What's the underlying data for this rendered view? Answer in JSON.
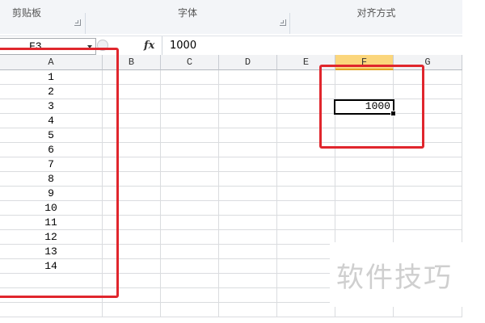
{
  "ribbon": {
    "groups": [
      {
        "caption": "剪贴板"
      },
      {
        "caption": "字体"
      },
      {
        "caption": "对齐方式"
      }
    ]
  },
  "formula_bar": {
    "name_box": "F3",
    "fx_label": "fx",
    "formula": "1000"
  },
  "grid": {
    "columns": [
      "A",
      "B",
      "C",
      "D",
      "E",
      "F",
      "G"
    ],
    "active_column": "F",
    "column_a_values": [
      "1",
      "2",
      "3",
      "4",
      "5",
      "6",
      "7",
      "8",
      "9",
      "10",
      "11",
      "12",
      "13",
      "14"
    ],
    "active_cell": {
      "address": "F3",
      "value": "1000"
    }
  },
  "annotations": {
    "highlight_color": "#e0262d"
  },
  "watermark": {
    "text": "软件技巧"
  }
}
